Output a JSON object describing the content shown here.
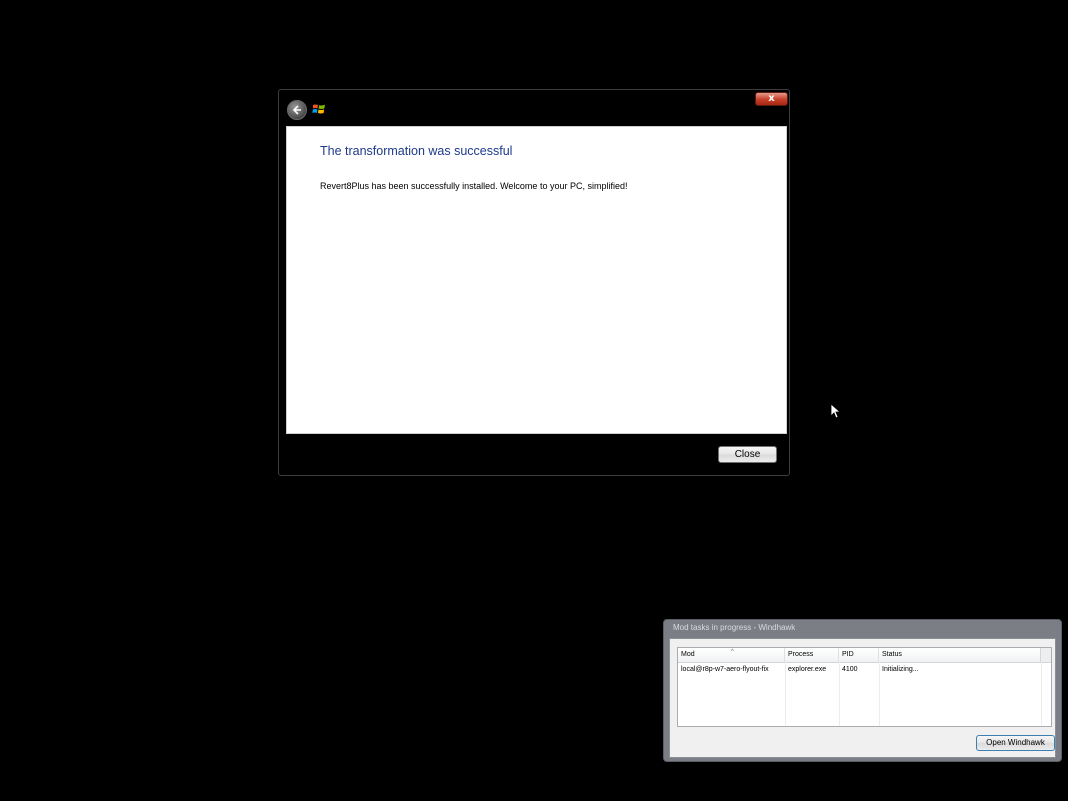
{
  "wizard": {
    "close_glyph": "x",
    "heading": "The transformation was successful",
    "message": "Revert8Plus has been successfully installed. Welcome to your PC, simplified!",
    "close_button": "Close",
    "icons": {
      "back": "back-arrow-icon",
      "app": "windows-logo-icon",
      "close": "close-icon"
    }
  },
  "tasks_window": {
    "title": "Mod tasks in progress - Windhawk",
    "columns": [
      "Mod",
      "Process",
      "PID",
      "Status"
    ],
    "rows": [
      {
        "mod": "local@r8p-w7-aero-flyout-fix",
        "process": "explorer.exe",
        "pid": "4100",
        "status": "Initializing..."
      }
    ],
    "open_button": "Open Windhawk"
  },
  "colors": {
    "desktop": "#000000",
    "heading_blue": "#1e3a8a",
    "close_red": "#c9442f"
  }
}
